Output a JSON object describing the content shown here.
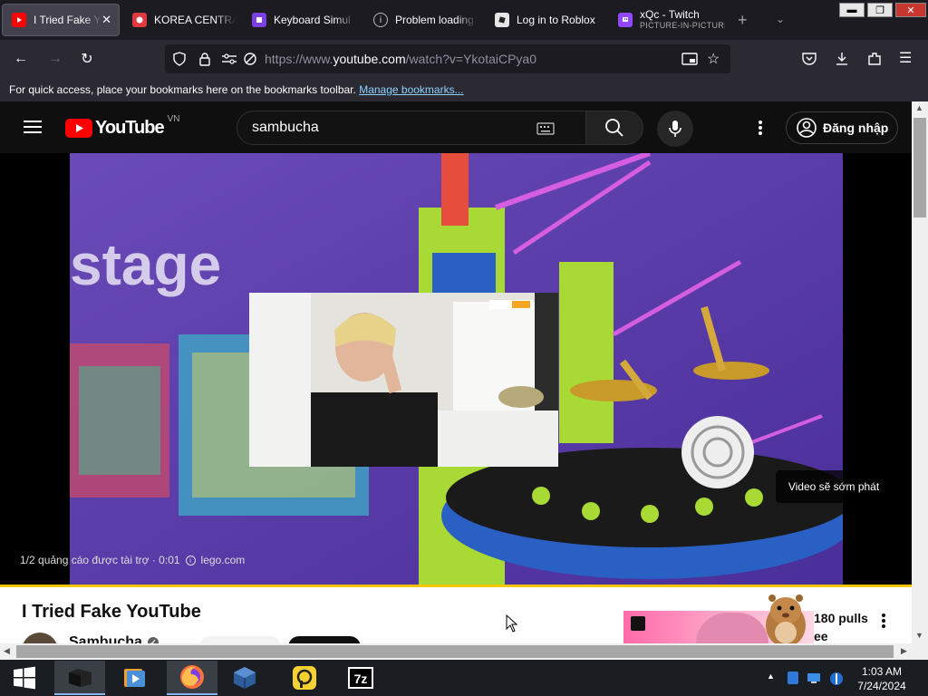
{
  "browser": {
    "tabs": [
      {
        "title": "I Tried Fake Yo",
        "active": true,
        "favicon_color": "#ff0000",
        "favicon": "youtube-favicon"
      },
      {
        "title": "KOREA CENTRAL",
        "active": false,
        "favicon_color": "#e03a3e",
        "favicon": "korea-favicon"
      },
      {
        "title": "Keyboard Simul",
        "active": false,
        "favicon_color": "#7b3fe4",
        "favicon": "keyboard-sim-favicon"
      },
      {
        "title": "Problem loading",
        "active": false,
        "favicon_color": "#1c1b22",
        "favicon": "info-favicon"
      },
      {
        "title": "Log in to Roblox",
        "active": false,
        "favicon_color": "#e6e6e6",
        "favicon": "roblox-favicon"
      },
      {
        "title": "xQc - Twitch",
        "subtitle": "PICTURE-IN-PICTURE",
        "active": false,
        "favicon_color": "#9146ff",
        "favicon": "twitch-favicon"
      }
    ],
    "url_prefix": "https://www.",
    "url_domain": "youtube.com",
    "url_path": "/watch?v=YkotaiCPya0",
    "bookmarks_text": "For quick access, place your bookmarks here on the bookmarks toolbar.",
    "bookmarks_link": "Manage bookmarks..."
  },
  "youtube": {
    "logo_text": "YouTube",
    "region": "VN",
    "search_value": "sambucha",
    "signin_label": "Đăng nhập",
    "ad_video": {
      "overlay_text": "stage",
      "ad_info": "1/2 quảng cáo được tài trợ · 0:01",
      "ad_domain": "lego.com",
      "skip_text": "Video sẽ sớm phát",
      "progress_fraction": 1.0
    },
    "video_title": "I Tried Fake YouTube",
    "channel_name": "Sambucha",
    "side_card_text1": "180 pulls",
    "side_card_text2": "ee"
  },
  "taskbar": {
    "time": "1:03 AM",
    "date": "7/24/2024",
    "apps": [
      "desktop-app",
      "media-player-app",
      "firefox-app",
      "virtualbox-app",
      "parsec-app",
      "7zip-app"
    ]
  },
  "colors": {
    "accent_red": "#ff0000",
    "ad_purple": "#5b3aa8",
    "progress_yellow": "#f6c600",
    "link_blue": "#8cd1ff"
  }
}
